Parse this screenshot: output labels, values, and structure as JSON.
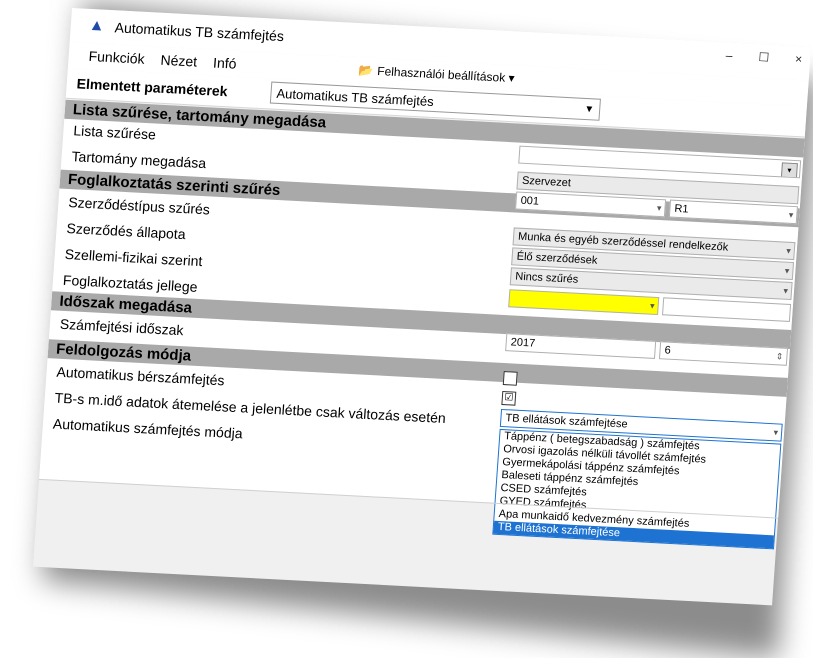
{
  "window": {
    "title": "Automatikus TB számfejtés",
    "min": "–",
    "max": "☐",
    "close": "×"
  },
  "menu": [
    "Funkciók",
    "Nézet",
    "Infó"
  ],
  "toolbar": {
    "label": "Elmentett paraméterek",
    "selected": "Automatikus TB számfejtés",
    "user_settings": "Felhasználói beállítások"
  },
  "sections": {
    "s1": "Lista szűrése, tartomány megadása",
    "s2": "Foglalkoztatás szerinti szűrés",
    "s3": "Időszak megadása",
    "s4": "Feldolgozás módja"
  },
  "labels": {
    "lista": "Lista szűrése",
    "tartomany": "Tartomány megadása",
    "szerz_tipus": "Szerződéstípus szűrés",
    "szerz_allapot": "Szerződés állapota",
    "szellemi": "Szellemi-fizikai szerint",
    "jelleg": "Foglalkoztatás jellege",
    "idoszak": "Számfejtési időszak",
    "auto_ber": "Automatikus bérszámfejtés",
    "tb_mido": "TB-s m.idő adatok átemelése a jelenlétbe csak változás esetén",
    "auto_mod": "Automatikus számfejtés módja"
  },
  "values": {
    "tartomany": "Szervezet",
    "tartomany2": "001",
    "tartomany3": "R1",
    "szerz_tipus": "Munka és egyéb szerződéssel rendelkezők",
    "szerz_allapot": "Élő szerződések",
    "szellemi": "Nincs szűrés",
    "ev": "2017",
    "honap": "6",
    "mod_selected": "TB ellátások számfejtése"
  },
  "checks": {
    "auto_ber": "",
    "tb_mido": "☑"
  },
  "dropdown": [
    "Táppénz ( betegszabadság ) számfejtés",
    "Orvosi igazolás nélküli távollét számfejtés",
    "Gyermekápolási táppénz számfejtés",
    "Baleseti táppénz számfejtés",
    "CSED számfejtés",
    "GYED számfejtés",
    "Apa munkaidő kedvezmény számfejtés",
    "TB ellátások számfejtése"
  ]
}
